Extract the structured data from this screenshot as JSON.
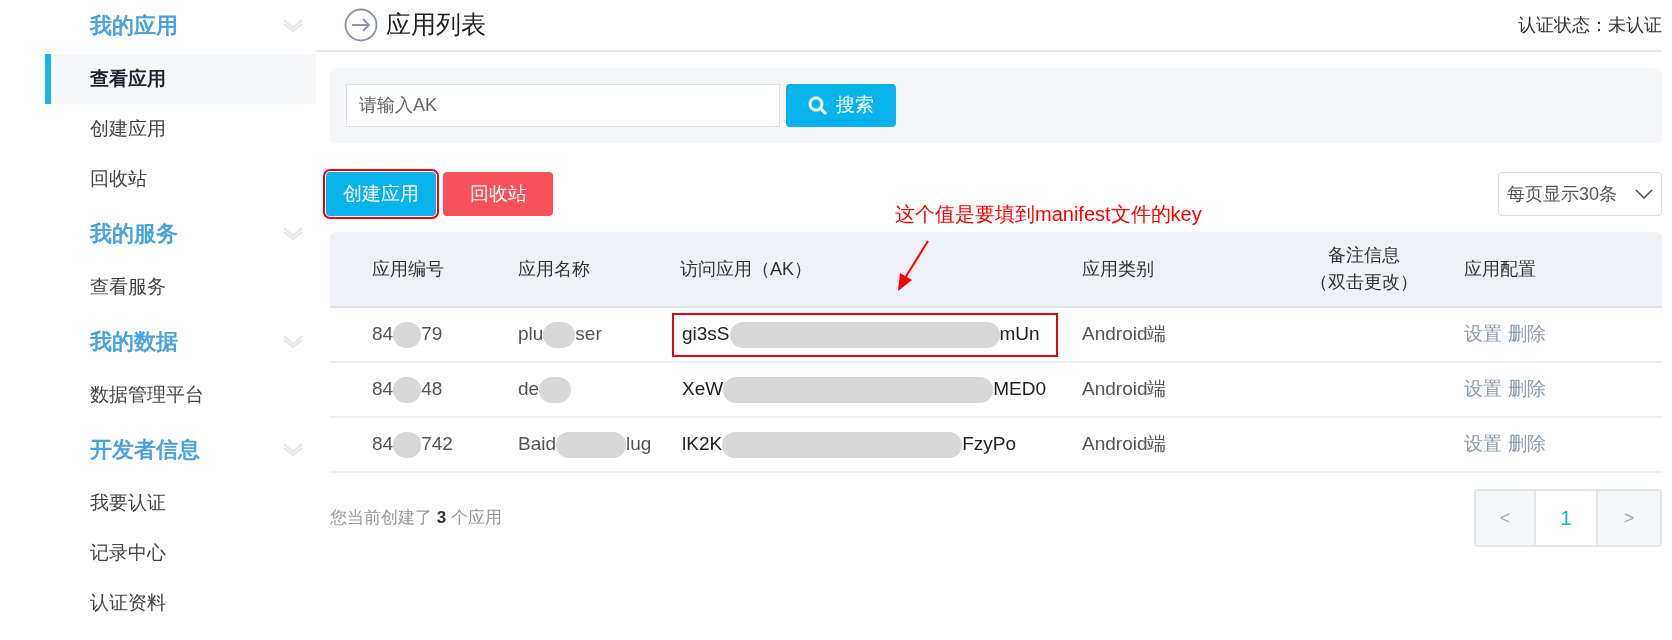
{
  "sidebar": {
    "sections": [
      {
        "title": "我的应用",
        "items": [
          {
            "label": "查看应用",
            "selected": true
          },
          {
            "label": "创建应用",
            "selected": false
          },
          {
            "label": "回收站",
            "selected": false
          }
        ]
      },
      {
        "title": "我的服务",
        "items": [
          {
            "label": "查看服务",
            "selected": false
          }
        ]
      },
      {
        "title": "我的数据",
        "items": [
          {
            "label": "数据管理平台",
            "selected": false
          }
        ]
      },
      {
        "title": "开发者信息",
        "items": [
          {
            "label": "我要认证",
            "selected": false
          },
          {
            "label": "记录中心",
            "selected": false
          },
          {
            "label": "认证资料",
            "selected": false
          }
        ]
      }
    ]
  },
  "header": {
    "title": "应用列表",
    "status": "认证状态：未认证"
  },
  "search": {
    "placeholder": "请输入AK",
    "button": "搜索"
  },
  "actions": [
    {
      "label": "创建应用",
      "kind": "primary",
      "outlined": true
    },
    {
      "label": "回收站",
      "kind": "danger",
      "outlined": false
    }
  ],
  "annotation": "这个值是要填到manifest文件的key",
  "page_size": "每页显示30条",
  "table": {
    "columns": [
      {
        "lines": [
          "应用编号"
        ]
      },
      {
        "lines": [
          "应用名称"
        ]
      },
      {
        "lines": [
          "访问应用（AK）"
        ]
      },
      {
        "lines": [
          "应用类别"
        ]
      },
      {
        "lines": [
          "备注信息",
          "（双击更改）"
        ]
      },
      {
        "lines": [
          "应用配置"
        ]
      }
    ],
    "rows": [
      {
        "id": {
          "start": "84",
          "end": "79"
        },
        "name": {
          "start": "plu",
          "end": "ser"
        },
        "ak": {
          "start": "gi3sS",
          "end": "mUn"
        },
        "ak_outlined": true,
        "type": "Android端",
        "links": [
          "设置",
          "删除"
        ]
      },
      {
        "id": {
          "start": "84",
          "end": "48"
        },
        "name": {
          "start": "de"
        },
        "ak": {
          "start": "XeW",
          "end": "MED0"
        },
        "ak_outlined": false,
        "type": "Android端",
        "links": [
          "设置",
          "删除"
        ]
      },
      {
        "id": {
          "start": "84",
          "end": "742"
        },
        "name": {
          "start": "Baid",
          "end": "lug"
        },
        "ak": {
          "start": "lK2K",
          "end": "FzyPo"
        },
        "ak_outlined": false,
        "type": "Android端",
        "links": [
          "设置",
          "删除"
        ]
      }
    ]
  },
  "summary": "您当前创建了 **3** 个应用",
  "pagination": {
    "prev": "<",
    "pages": [
      {
        "label": "1",
        "selected": true
      }
    ],
    "next": ">"
  }
}
